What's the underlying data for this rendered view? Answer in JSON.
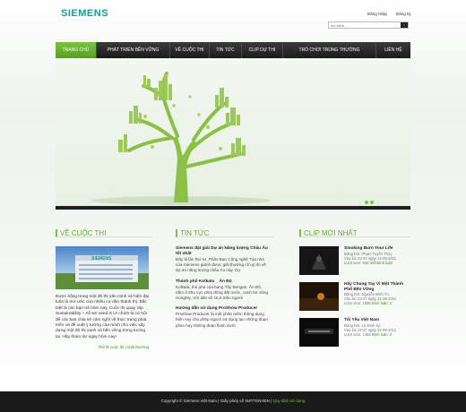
{
  "header": {
    "logo": "SIEMENS",
    "login": "Đăng nhập",
    "register": "Đăng ký",
    "search_placeholder": "tìm kiếm..."
  },
  "nav": [
    "TRANG CHỦ",
    "PHÁT TRIỂN BỀN VỮNG",
    "VỀ CUỘC THI",
    "TIN TỨC",
    "CLIP DỰ THI",
    "TRÒ CHƠI TRÚNG THƯỞNG",
    "LIÊN HỆ"
  ],
  "about": {
    "heading": "VỀ CUỘC THI",
    "text": "Được sống trong một đô thị văn minh và hiện đại luôn là mơ ước của nhiều cư dân thành thị. Bắc biệt là các bạn trẻ hôm nay. Cuộc thi quay clip Sustainability – All we need is U! chính là cơ hội để các bạn chia sẻ cảm nghĩ về thực trạng phát triển và đề xuất ý tưởng của mình cho việc xây dựng một đô thị xanh và bền vững trong tương lai. Hãy tham dự ngay hôm nay!",
    "links": "Thể lệ cuộc thi | Giải thưởng",
    "photo_sign": "SIEMENS"
  },
  "news": {
    "heading": "TIN TỨC",
    "items": [
      {
        "title": "Siemens đạt giải Dự án Năng lượng Châu Âu tốt nhất",
        "body": "Đây là lần thứ tư, Phân Ban Công nghệ Tòa nhà của Siemens giành được giải thưởng cố uy tín về dự án năng lượng châu Âu này. Dự"
      },
      {
        "title": "Thành phố Kolkata _ Ấn Độ",
        "body": "Kolkata, thủ phủ của bang Tây Bengan, Ấn Độ, nằm ở khu vực phía đông đất nước, cạnh bờ sông Hooghly. Với dân số 15,6 triệu người"
      },
      {
        "title": "Hướng dẫn sử dụng ProShow Producer",
        "body": "Proshow Producer là một phần mềm thông dụng hiện nay cho phép người sử dụng tạo những đoạn phim hay những đoạn flash dưới"
      }
    ]
  },
  "clips": {
    "heading": "CLIP MỚI NHẤT",
    "items": [
      {
        "title": "Smoking Burn Your Life",
        "author": "Đăng bởi: Phạm Tuyền Thủy",
        "date": "Vào lúc 22:07 ngày 12-09-2011",
        "views": "Lượt xem: 845",
        "comments": "Viết bình luận"
      },
      {
        "title": "Hãy Chung Tay Vì Một Thành Phố Bền Vững",
        "author": "Đăng bởi: Nguyễn Bình Tú",
        "date": "Vào lúc 23:47 ngày 31-08-2011",
        "views": "Lượt xem: 1888",
        "comments": "Bình luận: 2"
      },
      {
        "title": "Tôi Yêu Việt Nam",
        "author": "Đăng bởi: Lê Minh Ký",
        "date": "Vào lúc 22:37 ngày 31-08-2011",
        "views": "Lượt xem: 1484",
        "comments": "Bình luận: 2"
      }
    ]
  },
  "footer": {
    "copyright": "Copyright © Siemens Việt Nam | Giấy phép số 5MTTENVĐN",
    "terms": "Quy định sử dụng"
  }
}
